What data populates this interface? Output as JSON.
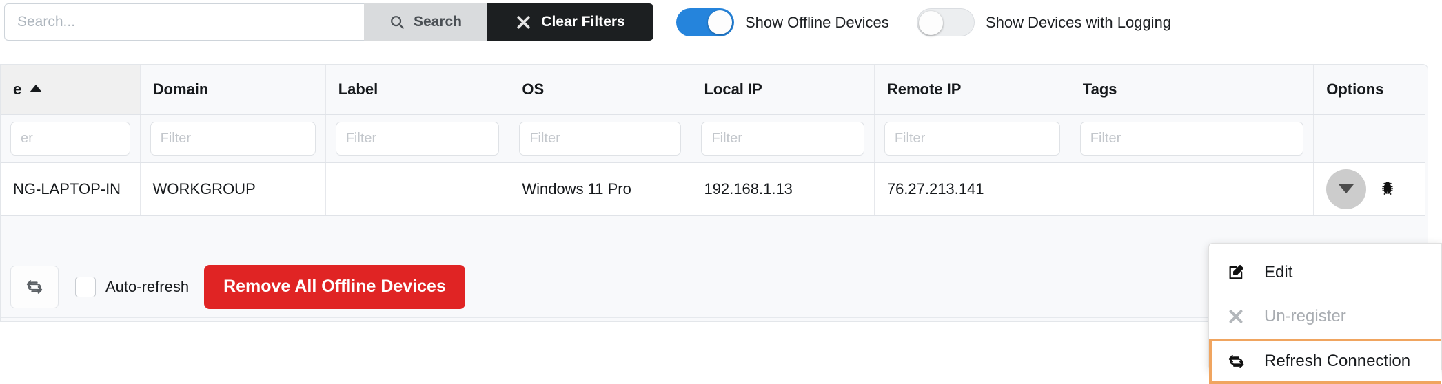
{
  "toolbar": {
    "search_placeholder": "Search...",
    "search_value": "",
    "search_button": "Search",
    "search_icon": "magnifier-icon",
    "clear_button": "Clear Filters",
    "clear_icon": "x-icon",
    "toggles": [
      {
        "label": "Show Offline Devices",
        "state": "on",
        "accent": "#2584dc"
      },
      {
        "label": "Show Devices with Logging",
        "state": "off",
        "accent": "#eceef0"
      }
    ]
  },
  "table": {
    "columns": [
      {
        "label": "e",
        "sorted": true,
        "sort_dir": "asc",
        "truncated_left": true
      },
      {
        "label": "Domain",
        "sorted": false
      },
      {
        "label": "Label",
        "sorted": false
      },
      {
        "label": "OS",
        "sorted": false
      },
      {
        "label": "Local IP",
        "sorted": false
      },
      {
        "label": "Remote IP",
        "sorted": false
      },
      {
        "label": "Tags",
        "sorted": false
      },
      {
        "label": "Options",
        "sorted": false
      }
    ],
    "filters": [
      {
        "placeholder": "er",
        "value": ""
      },
      {
        "placeholder": "Filter",
        "value": ""
      },
      {
        "placeholder": "Filter",
        "value": ""
      },
      {
        "placeholder": "Filter",
        "value": ""
      },
      {
        "placeholder": "Filter",
        "value": ""
      },
      {
        "placeholder": "Filter",
        "value": ""
      },
      {
        "placeholder": "Filter",
        "value": ""
      }
    ],
    "rows": [
      {
        "name": "NG-LAPTOP-IN",
        "domain": "WORKGROUP",
        "label": "",
        "os": "Windows 11 Pro",
        "local_ip": "192.168.1.13",
        "remote_ip": "76.27.213.141",
        "tags": "",
        "options": {
          "dropdown_icon": "caret-down-icon",
          "bug_icon": "bug-icon"
        }
      }
    ]
  },
  "footer": {
    "refresh_icon": "refresh-icon",
    "auto_refresh_label": "Auto-refresh",
    "auto_refresh_checked": false,
    "remove_button": "Remove All Offline Devices",
    "remove_button_color": "#e02424"
  },
  "context_menu": {
    "highlight_color": "#f0a560",
    "items": [
      {
        "label": "Edit",
        "icon": "edit-pencil-icon",
        "disabled": false,
        "highlighted": false
      },
      {
        "label": "Un-register",
        "icon": "x-icon",
        "disabled": true,
        "highlighted": false
      },
      {
        "label": "Refresh Connection",
        "icon": "refresh-icon",
        "disabled": false,
        "highlighted": true
      }
    ]
  }
}
